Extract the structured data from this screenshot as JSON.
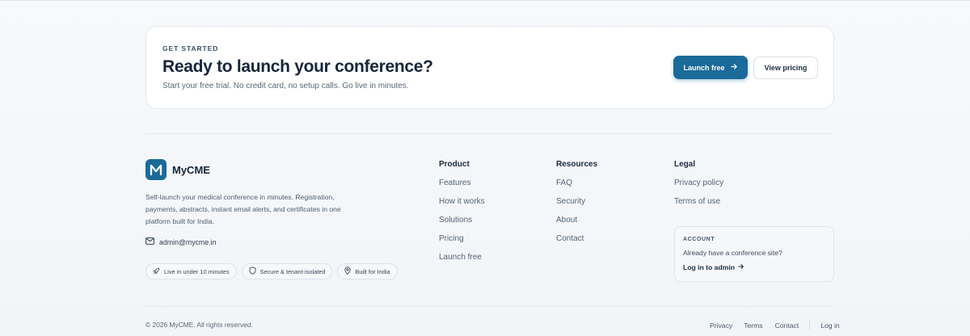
{
  "cta": {
    "eyebrow": "GET STARTED",
    "title": "Ready to launch your conference?",
    "subtitle": "Start your free trial. No credit card, no setup calls. Go live in minutes.",
    "primary_label": "Launch free",
    "primary_icon": "arrow-right-icon",
    "secondary_label": "View pricing"
  },
  "brand": {
    "logo_letter": "M",
    "name": "MyCME",
    "description": "Self-launch your medical conference in minutes. Registration, payments, abstracts, instant email alerts, and certificates in one platform built for India.",
    "email": "admin@mycme.in",
    "accent_color": "#1a6a9a",
    "badges": [
      {
        "icon": "rocket-icon",
        "label": "Live in under 10 minutes"
      },
      {
        "icon": "shield-icon",
        "label": "Secure & tenant-isolated"
      },
      {
        "icon": "map-pin-icon",
        "label": "Built for India"
      }
    ]
  },
  "columns": {
    "product": {
      "heading": "Product",
      "links": [
        "Features",
        "How it works",
        "Solutions",
        "Pricing",
        "Launch free"
      ]
    },
    "resources": {
      "heading": "Resources",
      "links": [
        "FAQ",
        "Security",
        "About",
        "Contact"
      ]
    },
    "legal": {
      "heading": "Legal",
      "links": [
        "Privacy policy",
        "Terms of use"
      ]
    }
  },
  "account": {
    "eyebrow": "ACCOUNT",
    "text": "Already have a conference site?",
    "link": "Log in to admin"
  },
  "footer": {
    "copyright": "© 2026 MyCME. All rights reserved.",
    "links": [
      "Privacy",
      "Terms",
      "Contact"
    ],
    "login": "Log in"
  }
}
